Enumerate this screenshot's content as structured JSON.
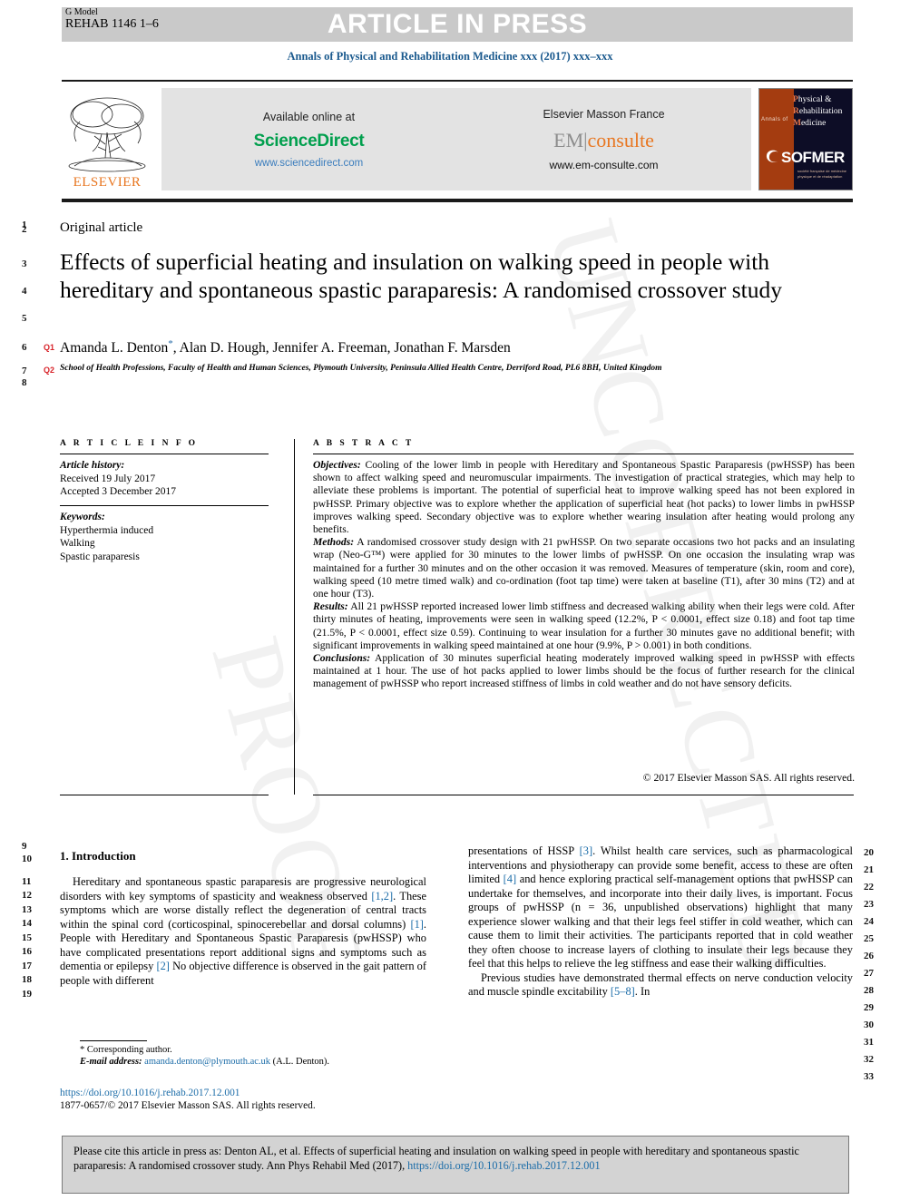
{
  "header": {
    "g_model_label": "G Model",
    "g_model_code": "REHAB 1146 1–6",
    "banner_text": "ARTICLE IN PRESS",
    "journal_line": "Annals of Physical and Rehabilitation Medicine xxx (2017) xxx–xxx"
  },
  "masthead": {
    "elsevier_word": "ELSEVIER",
    "available_online": "Available online at",
    "sciencedirect": "ScienceDirect",
    "sciencedirect_url": "www.sciencedirect.com",
    "elsevier_masson": "Elsevier Masson France",
    "em_prefix": "EM",
    "em_suffix": "consulte",
    "em_url": "www.em-consulte.com",
    "cover": {
      "annals_of": "Annals of",
      "line1_initial": "P",
      "line1_rest": "hysical &",
      "line2_initial": "R",
      "line2_rest": "ehabilitation",
      "line3_initial": "M",
      "line3_rest": "edicine",
      "sofmer": "SOFMER",
      "sofmer_sub": "société française de médecine physique et de réadaptation"
    }
  },
  "article": {
    "type": "Original article",
    "title": "Effects of superficial heating and insulation on walking speed in people with hereditary and spontaneous spastic paraparesis: A randomised crossover study",
    "authors": "Amanda L. Denton",
    "authors_rest": ", Alan D. Hough, Jennifer A. Freeman, Jonathan F. Marsden",
    "corresponding_marker": "*",
    "affiliation": "School of Health Professions, Faculty of Health and Human Sciences, Plymouth University, Peninsula Allied Health Centre, Derriford Road, PL6 8BH, United Kingdom",
    "query_tags": [
      "Q1",
      "Q2"
    ]
  },
  "article_info": {
    "heading": "A R T I C L E   I N F O",
    "history_label": "Article history:",
    "received": "Received 19 July 2017",
    "accepted": "Accepted 3 December 2017",
    "keywords_label": "Keywords:",
    "keywords": [
      "Hyperthermia induced",
      "Walking",
      "Spastic paraparesis"
    ]
  },
  "abstract": {
    "heading": "A B S T R A C T",
    "objectives_label": "Objectives:",
    "objectives": " Cooling of the lower limb in people with Hereditary and Spontaneous Spastic Paraparesis (pwHSSP) has been shown to affect walking speed and neuromuscular impairments. The investigation of practical strategies, which may help to alleviate these problems is important. The potential of superficial heat to improve walking speed has not been explored in pwHSSP. Primary objective was to explore whether the application of superficial heat (hot packs) to lower limbs in pwHSSP improves walking speed. Secondary objective was to explore whether wearing insulation after heating would prolong any benefits.",
    "methods_label": "Methods:",
    "methods": " A randomised crossover study design with 21 pwHSSP. On two separate occasions two hot packs and an insulating wrap (Neo-G™) were applied for 30 minutes to the lower limbs of pwHSSP. On one occasion the insulating wrap was maintained for a further 30 minutes and on the other occasion it was removed. Measures of temperature (skin, room and core), walking speed (10 metre timed walk) and co-ordination (foot tap time) were taken at baseline (T1), after 30 mins (T2) and at one hour (T3).",
    "results_label": "Results:",
    "results": " All 21 pwHSSP reported increased lower limb stiffness and decreased walking ability when their legs were cold. After thirty minutes of heating, improvements were seen in walking speed (12.2%, P < 0.0001, effect size 0.18) and foot tap time (21.5%, P < 0.0001, effect size 0.59). Continuing to wear insulation for a further 30 minutes gave no additional benefit; with significant improvements in walking speed maintained at one hour (9.9%, P > 0.001) in both conditions.",
    "conclusions_label": "Conclusions:",
    "conclusions": " Application of 30 minutes superficial heating moderately improved walking speed in pwHSSP with effects maintained at 1 hour. The use of hot packs applied to lower limbs should be the focus of further research for the clinical management of pwHSSP who report increased stiffness of limbs in cold weather and do not have sensory deficits.",
    "copyright": "© 2017 Elsevier Masson SAS. All rights reserved."
  },
  "body": {
    "section_heading": "1. Introduction",
    "left_paragraph_pre": "Hereditary and spontaneous spastic paraparesis are progressive neurological disorders with key symptoms of spasticity and weakness observed ",
    "ref_12": "[1,2]",
    "left_paragraph_mid": ". These symptoms which are worse distally reflect the degeneration of central tracts within the spinal cord (corticospinal, spinocerebellar and dorsal columns) ",
    "ref_1": "[1]",
    "left_paragraph_mid2": ". People with Hereditary and Spontaneous Spastic Paraparesis (pwHSSP) who have complicated presentations report additional signs and symptoms such as dementia or epilepsy ",
    "ref_2": "[2]",
    "left_paragraph_end": " No objective difference is observed in the gait pattern of people with different",
    "right_paragraph_pre": "presentations of HSSP ",
    "ref_3": "[3]",
    "right_paragraph_mid": ". Whilst health care services, such as pharmacological interventions and physiotherapy can provide some benefit, access to these are often limited ",
    "ref_4": "[4]",
    "right_paragraph_mid2": " and hence exploring practical self-management options that pwHSSP can undertake for themselves, and incorporate into their daily lives, is important. Focus groups of pwHSSP (n = 36, unpublished observations) highlight that many experience slower walking and that their legs feel stiffer in cold weather, which can cause them to limit their activities. The participants reported that in cold weather they often choose to increase layers of clothing to insulate their legs because they feel that this helps to relieve the leg stiffness and ease their walking difficulties.",
    "right_paragraph2_pre": "Previous studies have demonstrated thermal effects on nerve conduction velocity and muscle spindle excitability ",
    "ref_58": "[5–8]",
    "right_paragraph2_end": ". In"
  },
  "footnotes": {
    "corresponding": "* Corresponding author.",
    "email_label": "E-mail address:",
    "email": "amanda.denton@plymouth.ac.uk",
    "email_owner": " (A.L. Denton).",
    "doi": "https://doi.org/10.1016/j.rehab.2017.12.001",
    "issn_line": "1877-0657/© 2017 Elsevier Masson SAS. All rights reserved."
  },
  "cite_box": {
    "text_pre": "Please cite this article in press as: Denton AL, et al. Effects of superficial heating and insulation on walking speed in people with hereditary and spontaneous spastic paraparesis: A randomised crossover study. Ann Phys Rehabil Med (2017), ",
    "link": "https://doi.org/10.1016/j.rehab.2017.12.001"
  },
  "line_numbers": {
    "left": [
      "1",
      "2",
      "3",
      "4",
      "5",
      "6",
      "7",
      "8",
      "9",
      "10",
      "11",
      "12",
      "13",
      "14",
      "15",
      "16",
      "17",
      "18",
      "19"
    ],
    "right": [
      "20",
      "21",
      "22",
      "23",
      "24",
      "25",
      "26",
      "27",
      "28",
      "29",
      "30",
      "31",
      "32",
      "33"
    ]
  },
  "watermark": {
    "text1": "UNCORRECTED",
    "text2": "PROOF"
  },
  "colors": {
    "banner_grey": "#c9c9c9",
    "journal_blue": "#1b5a8e",
    "sciencedirect_green": "#009f4d",
    "elsevier_orange": "#e87722",
    "link_blue": "#1b6ca8",
    "query_red": "#d8232a"
  }
}
